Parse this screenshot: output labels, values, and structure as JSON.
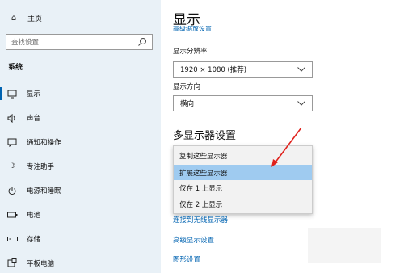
{
  "sidebar": {
    "home_label": "主页",
    "search_placeholder": "查找设置",
    "section_label": "系统",
    "items": [
      {
        "label": "显示",
        "icon": "monitor-icon"
      },
      {
        "label": "声音",
        "icon": "speaker-icon"
      },
      {
        "label": "通知和操作",
        "icon": "notification-icon"
      },
      {
        "label": "专注助手",
        "icon": "moon-icon"
      },
      {
        "label": "电源和睡眠",
        "icon": "power-icon"
      },
      {
        "label": "电池",
        "icon": "battery-icon"
      },
      {
        "label": "存储",
        "icon": "storage-icon"
      },
      {
        "label": "平板电脑",
        "icon": "tablet-icon"
      }
    ]
  },
  "main": {
    "title": "显示",
    "sub_link": "高级缩放设置",
    "resolution_label": "显示分辨率",
    "resolution_value": "1920 × 1080 (推荐)",
    "orientation_label": "显示方向",
    "orientation_value": "横向",
    "multi_display_heading": "多显示器设置",
    "dropdown_options": [
      "复制这些显示器",
      "扩展这些显示器",
      "仅在 1 上显示",
      "仅在 2 上显示"
    ],
    "dropdown_selected_index": 1,
    "wireless_link": "连接到无线显示器",
    "advanced_link": "高级显示设置",
    "graphics_link": "图形设置"
  },
  "colors": {
    "accent": "#0063b1",
    "sidebar_bg": "#e9f1f7",
    "selected_bg": "#9fcbf0",
    "arrow": "#e0201b"
  }
}
